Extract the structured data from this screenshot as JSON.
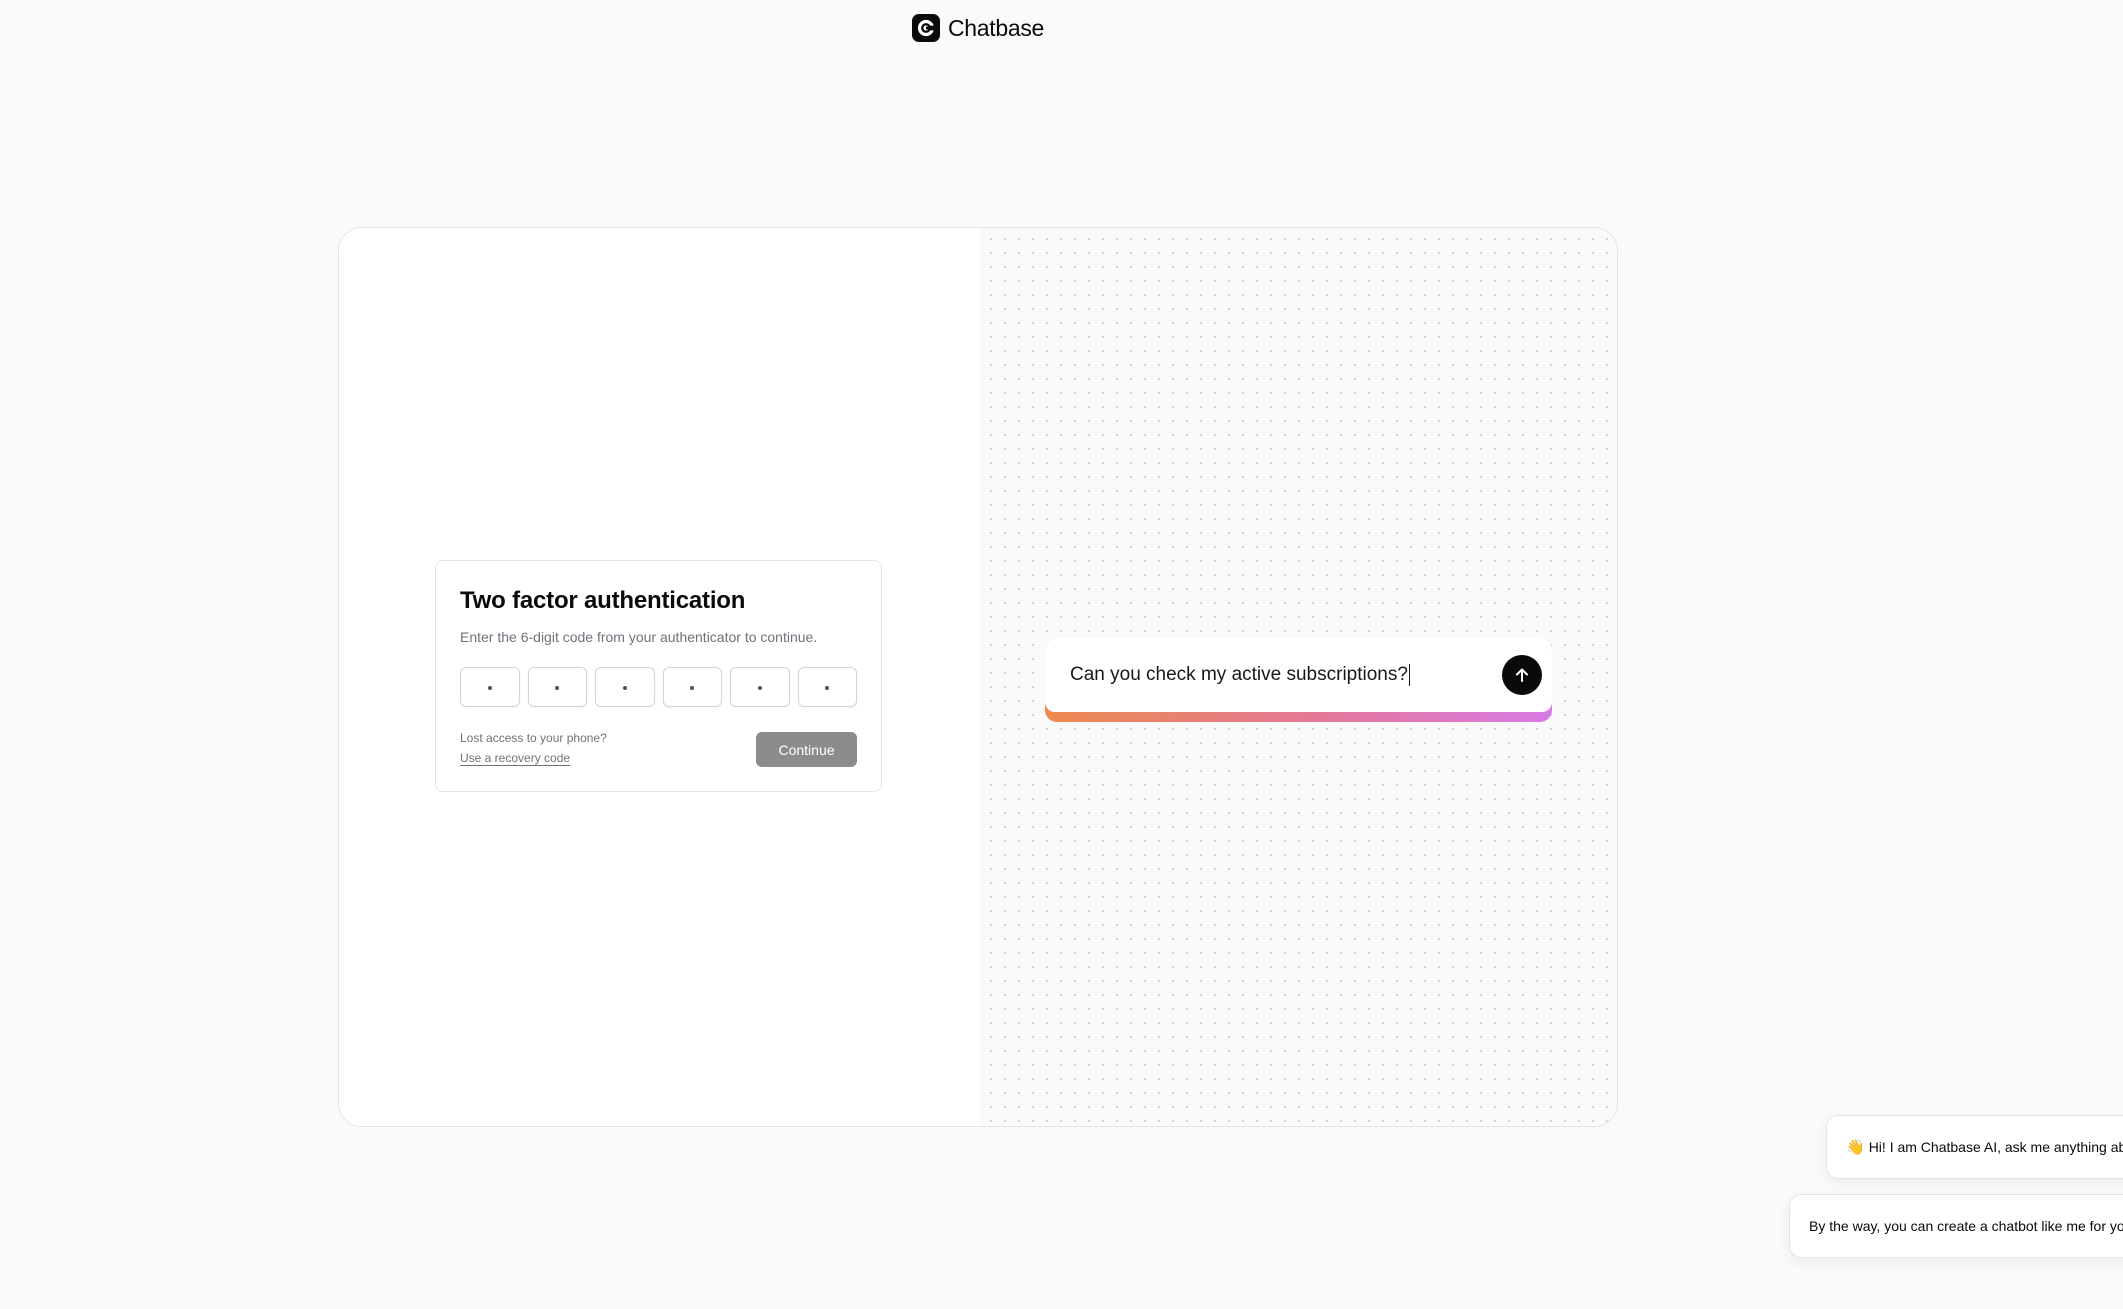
{
  "brand": {
    "name": "Chatbase",
    "logo_icon": "chatbase-c-icon"
  },
  "auth": {
    "title": "Two factor authentication",
    "subtitle": "Enter the 6-digit code from your authenticator to continue.",
    "otp_digits": [
      "",
      "",
      "",
      "",
      "",
      ""
    ],
    "lost_access_text": "Lost access to your phone?",
    "recovery_link": "Use a recovery code",
    "continue_label": "Continue"
  },
  "chat_demo": {
    "input_text": "Can you check my active subscriptions?",
    "send_icon": "arrow-up-icon",
    "gradient_colors": [
      "#ec8a4e",
      "#e4789a",
      "#d77ae6"
    ]
  },
  "widget": {
    "bubble_1": {
      "emoji": "👋",
      "text": "Hi! I am Chatbase AI, ask me anything ab"
    },
    "bubble_2": {
      "text": "By the way, you can create a chatbot like me for yo"
    }
  },
  "colors": {
    "page_bg": "#fafafa",
    "continue_disabled": "#8c8c8c",
    "text_primary": "#0a0a0a",
    "text_muted": "#71717a"
  }
}
